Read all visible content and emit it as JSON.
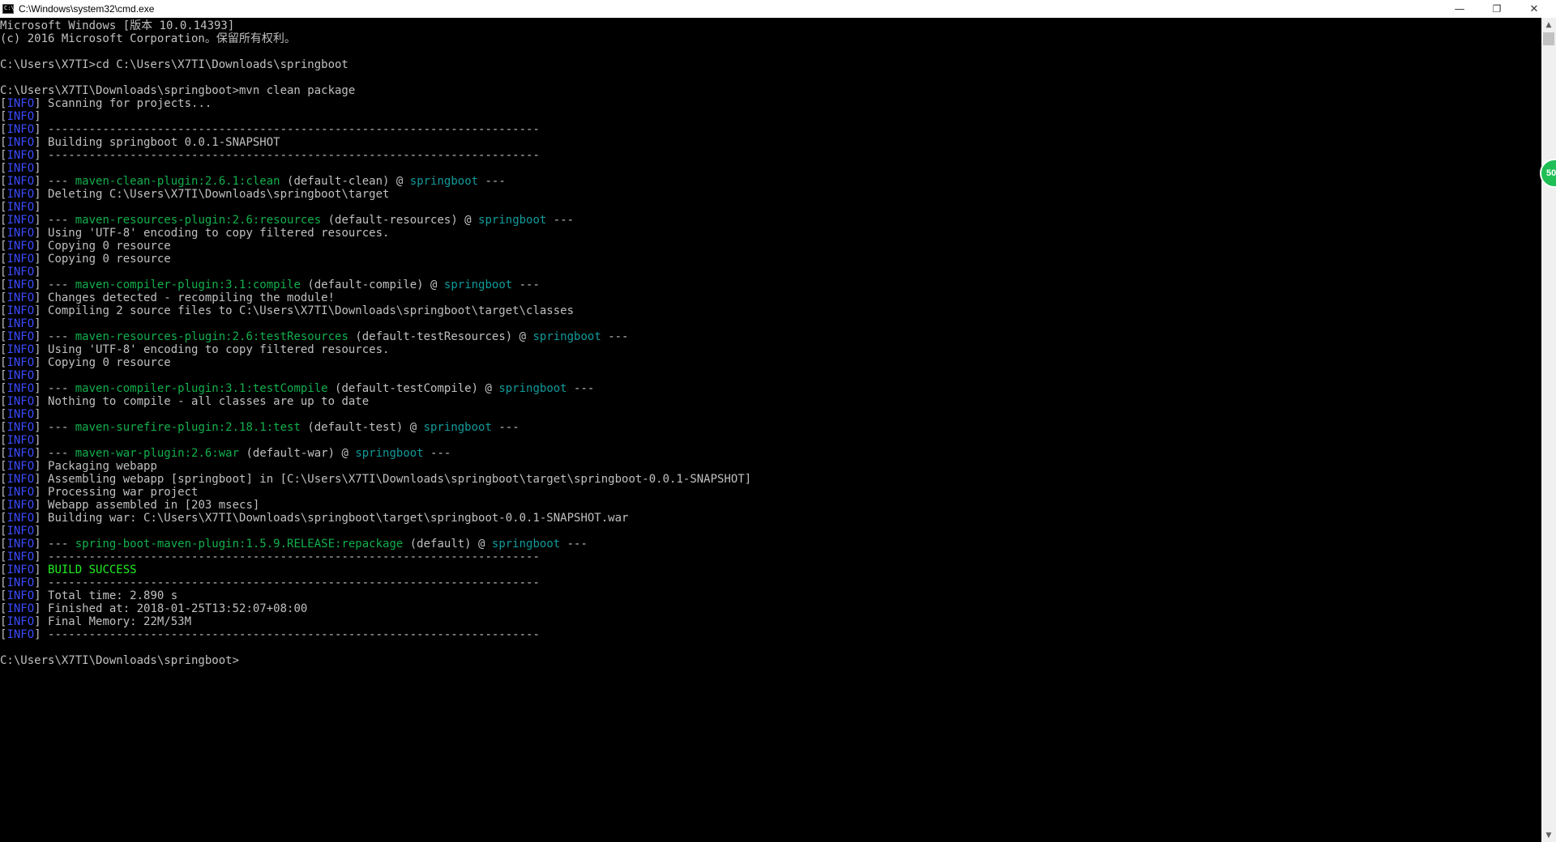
{
  "window": {
    "title": "C:\\Windows\\system32\\cmd.exe",
    "icon_text": "C:\\",
    "minimize_label": "—",
    "restore_label": "❐",
    "close_label": "✕"
  },
  "badge": {
    "text": "50"
  },
  "scrollbar": {
    "up_arrow": "▲",
    "down_arrow": "▼"
  },
  "colors": {
    "background": "#000000",
    "text": "#c0c0c0",
    "info_tag": "#3b4bff",
    "plugin": "#12b04c",
    "project": "#129a9a",
    "success": "#22ee22"
  },
  "console": {
    "lines": [
      [
        {
          "t": "Microsoft Windows [版本 10.0.14393]",
          "c": "default"
        }
      ],
      [
        {
          "t": "(c) 2016 Microsoft Corporation。保留所有权利。",
          "c": "default"
        }
      ],
      [],
      [
        {
          "t": "C:\\Users\\X7TI>cd C:\\Users\\X7TI\\Downloads\\springboot",
          "c": "default"
        }
      ],
      [],
      [
        {
          "t": "C:\\Users\\X7TI\\Downloads\\springboot>mvn clean package",
          "c": "default"
        }
      ],
      [
        {
          "t": "[",
          "c": "default"
        },
        {
          "t": "INFO",
          "c": "blue"
        },
        {
          "t": "] Scanning for projects...",
          "c": "default"
        }
      ],
      [
        {
          "t": "[",
          "c": "default"
        },
        {
          "t": "INFO",
          "c": "blue"
        },
        {
          "t": "]",
          "c": "default"
        }
      ],
      [
        {
          "t": "[",
          "c": "default"
        },
        {
          "t": "INFO",
          "c": "blue"
        },
        {
          "t": "] ------------------------------------------------------------------------",
          "c": "default"
        }
      ],
      [
        {
          "t": "[",
          "c": "default"
        },
        {
          "t": "INFO",
          "c": "blue"
        },
        {
          "t": "] Building springboot 0.0.1-SNAPSHOT",
          "c": "default"
        }
      ],
      [
        {
          "t": "[",
          "c": "default"
        },
        {
          "t": "INFO",
          "c": "blue"
        },
        {
          "t": "] ------------------------------------------------------------------------",
          "c": "default"
        }
      ],
      [
        {
          "t": "[",
          "c": "default"
        },
        {
          "t": "INFO",
          "c": "blue"
        },
        {
          "t": "]",
          "c": "default"
        }
      ],
      [
        {
          "t": "[",
          "c": "default"
        },
        {
          "t": "INFO",
          "c": "blue"
        },
        {
          "t": "] --- ",
          "c": "default"
        },
        {
          "t": "maven-clean-plugin:2.6.1:clean",
          "c": "green"
        },
        {
          "t": " (default-clean) @ ",
          "c": "default"
        },
        {
          "t": "springboot",
          "c": "teal"
        },
        {
          "t": " ---",
          "c": "default"
        }
      ],
      [
        {
          "t": "[",
          "c": "default"
        },
        {
          "t": "INFO",
          "c": "blue"
        },
        {
          "t": "] Deleting C:\\Users\\X7TI\\Downloads\\springboot\\target",
          "c": "default"
        }
      ],
      [
        {
          "t": "[",
          "c": "default"
        },
        {
          "t": "INFO",
          "c": "blue"
        },
        {
          "t": "]",
          "c": "default"
        }
      ],
      [
        {
          "t": "[",
          "c": "default"
        },
        {
          "t": "INFO",
          "c": "blue"
        },
        {
          "t": "] --- ",
          "c": "default"
        },
        {
          "t": "maven-resources-plugin:2.6:resources",
          "c": "green"
        },
        {
          "t": " (default-resources) @ ",
          "c": "default"
        },
        {
          "t": "springboot",
          "c": "teal"
        },
        {
          "t": " ---",
          "c": "default"
        }
      ],
      [
        {
          "t": "[",
          "c": "default"
        },
        {
          "t": "INFO",
          "c": "blue"
        },
        {
          "t": "] Using 'UTF-8' encoding to copy filtered resources.",
          "c": "default"
        }
      ],
      [
        {
          "t": "[",
          "c": "default"
        },
        {
          "t": "INFO",
          "c": "blue"
        },
        {
          "t": "] Copying 0 resource",
          "c": "default"
        }
      ],
      [
        {
          "t": "[",
          "c": "default"
        },
        {
          "t": "INFO",
          "c": "blue"
        },
        {
          "t": "] Copying 0 resource",
          "c": "default"
        }
      ],
      [
        {
          "t": "[",
          "c": "default"
        },
        {
          "t": "INFO",
          "c": "blue"
        },
        {
          "t": "]",
          "c": "default"
        }
      ],
      [
        {
          "t": "[",
          "c": "default"
        },
        {
          "t": "INFO",
          "c": "blue"
        },
        {
          "t": "] --- ",
          "c": "default"
        },
        {
          "t": "maven-compiler-plugin:3.1:compile",
          "c": "green"
        },
        {
          "t": " (default-compile) @ ",
          "c": "default"
        },
        {
          "t": "springboot",
          "c": "teal"
        },
        {
          "t": " ---",
          "c": "default"
        }
      ],
      [
        {
          "t": "[",
          "c": "default"
        },
        {
          "t": "INFO",
          "c": "blue"
        },
        {
          "t": "] Changes detected - recompiling the module!",
          "c": "default"
        }
      ],
      [
        {
          "t": "[",
          "c": "default"
        },
        {
          "t": "INFO",
          "c": "blue"
        },
        {
          "t": "] Compiling 2 source files to C:\\Users\\X7TI\\Downloads\\springboot\\target\\classes",
          "c": "default"
        }
      ],
      [
        {
          "t": "[",
          "c": "default"
        },
        {
          "t": "INFO",
          "c": "blue"
        },
        {
          "t": "]",
          "c": "default"
        }
      ],
      [
        {
          "t": "[",
          "c": "default"
        },
        {
          "t": "INFO",
          "c": "blue"
        },
        {
          "t": "] --- ",
          "c": "default"
        },
        {
          "t": "maven-resources-plugin:2.6:testResources",
          "c": "green"
        },
        {
          "t": " (default-testResources) @ ",
          "c": "default"
        },
        {
          "t": "springboot",
          "c": "teal"
        },
        {
          "t": " ---",
          "c": "default"
        }
      ],
      [
        {
          "t": "[",
          "c": "default"
        },
        {
          "t": "INFO",
          "c": "blue"
        },
        {
          "t": "] Using 'UTF-8' encoding to copy filtered resources.",
          "c": "default"
        }
      ],
      [
        {
          "t": "[",
          "c": "default"
        },
        {
          "t": "INFO",
          "c": "blue"
        },
        {
          "t": "] Copying 0 resource",
          "c": "default"
        }
      ],
      [
        {
          "t": "[",
          "c": "default"
        },
        {
          "t": "INFO",
          "c": "blue"
        },
        {
          "t": "]",
          "c": "default"
        }
      ],
      [
        {
          "t": "[",
          "c": "default"
        },
        {
          "t": "INFO",
          "c": "blue"
        },
        {
          "t": "] --- ",
          "c": "default"
        },
        {
          "t": "maven-compiler-plugin:3.1:testCompile",
          "c": "green"
        },
        {
          "t": " (default-testCompile) @ ",
          "c": "default"
        },
        {
          "t": "springboot",
          "c": "teal"
        },
        {
          "t": " ---",
          "c": "default"
        }
      ],
      [
        {
          "t": "[",
          "c": "default"
        },
        {
          "t": "INFO",
          "c": "blue"
        },
        {
          "t": "] Nothing to compile - all classes are up to date",
          "c": "default"
        }
      ],
      [
        {
          "t": "[",
          "c": "default"
        },
        {
          "t": "INFO",
          "c": "blue"
        },
        {
          "t": "]",
          "c": "default"
        }
      ],
      [
        {
          "t": "[",
          "c": "default"
        },
        {
          "t": "INFO",
          "c": "blue"
        },
        {
          "t": "] --- ",
          "c": "default"
        },
        {
          "t": "maven-surefire-plugin:2.18.1:test",
          "c": "green"
        },
        {
          "t": " (default-test) @ ",
          "c": "default"
        },
        {
          "t": "springboot",
          "c": "teal"
        },
        {
          "t": " ---",
          "c": "default"
        }
      ],
      [
        {
          "t": "[",
          "c": "default"
        },
        {
          "t": "INFO",
          "c": "blue"
        },
        {
          "t": "]",
          "c": "default"
        }
      ],
      [
        {
          "t": "[",
          "c": "default"
        },
        {
          "t": "INFO",
          "c": "blue"
        },
        {
          "t": "] --- ",
          "c": "default"
        },
        {
          "t": "maven-war-plugin:2.6:war",
          "c": "green"
        },
        {
          "t": " (default-war) @ ",
          "c": "default"
        },
        {
          "t": "springboot",
          "c": "teal"
        },
        {
          "t": " ---",
          "c": "default"
        }
      ],
      [
        {
          "t": "[",
          "c": "default"
        },
        {
          "t": "INFO",
          "c": "blue"
        },
        {
          "t": "] Packaging webapp",
          "c": "default"
        }
      ],
      [
        {
          "t": "[",
          "c": "default"
        },
        {
          "t": "INFO",
          "c": "blue"
        },
        {
          "t": "] Assembling webapp [springboot] in [C:\\Users\\X7TI\\Downloads\\springboot\\target\\springboot-0.0.1-SNAPSHOT]",
          "c": "default"
        }
      ],
      [
        {
          "t": "[",
          "c": "default"
        },
        {
          "t": "INFO",
          "c": "blue"
        },
        {
          "t": "] Processing war project",
          "c": "default"
        }
      ],
      [
        {
          "t": "[",
          "c": "default"
        },
        {
          "t": "INFO",
          "c": "blue"
        },
        {
          "t": "] Webapp assembled in [203 msecs]",
          "c": "default"
        }
      ],
      [
        {
          "t": "[",
          "c": "default"
        },
        {
          "t": "INFO",
          "c": "blue"
        },
        {
          "t": "] Building war: C:\\Users\\X7TI\\Downloads\\springboot\\target\\springboot-0.0.1-SNAPSHOT.war",
          "c": "default"
        }
      ],
      [
        {
          "t": "[",
          "c": "default"
        },
        {
          "t": "INFO",
          "c": "blue"
        },
        {
          "t": "]",
          "c": "default"
        }
      ],
      [
        {
          "t": "[",
          "c": "default"
        },
        {
          "t": "INFO",
          "c": "blue"
        },
        {
          "t": "] --- ",
          "c": "default"
        },
        {
          "t": "spring-boot-maven-plugin:1.5.9.RELEASE:repackage",
          "c": "green"
        },
        {
          "t": " (default) @ ",
          "c": "default"
        },
        {
          "t": "springboot",
          "c": "teal"
        },
        {
          "t": " ---",
          "c": "default"
        }
      ],
      [
        {
          "t": "[",
          "c": "default"
        },
        {
          "t": "INFO",
          "c": "blue"
        },
        {
          "t": "] ------------------------------------------------------------------------",
          "c": "default"
        }
      ],
      [
        {
          "t": "[",
          "c": "default"
        },
        {
          "t": "INFO",
          "c": "blue"
        },
        {
          "t": "] ",
          "c": "default"
        },
        {
          "t": "BUILD SUCCESS",
          "c": "bright"
        }
      ],
      [
        {
          "t": "[",
          "c": "default"
        },
        {
          "t": "INFO",
          "c": "blue"
        },
        {
          "t": "] ------------------------------------------------------------------------",
          "c": "default"
        }
      ],
      [
        {
          "t": "[",
          "c": "default"
        },
        {
          "t": "INFO",
          "c": "blue"
        },
        {
          "t": "] Total time: 2.890 s",
          "c": "default"
        }
      ],
      [
        {
          "t": "[",
          "c": "default"
        },
        {
          "t": "INFO",
          "c": "blue"
        },
        {
          "t": "] Finished at: 2018-01-25T13:52:07+08:00",
          "c": "default"
        }
      ],
      [
        {
          "t": "[",
          "c": "default"
        },
        {
          "t": "INFO",
          "c": "blue"
        },
        {
          "t": "] Final Memory: 22M/53M",
          "c": "default"
        }
      ],
      [
        {
          "t": "[",
          "c": "default"
        },
        {
          "t": "INFO",
          "c": "blue"
        },
        {
          "t": "] ------------------------------------------------------------------------",
          "c": "default"
        }
      ],
      [],
      [
        {
          "t": "C:\\Users\\X7TI\\Downloads\\springboot>",
          "c": "default"
        }
      ]
    ]
  }
}
